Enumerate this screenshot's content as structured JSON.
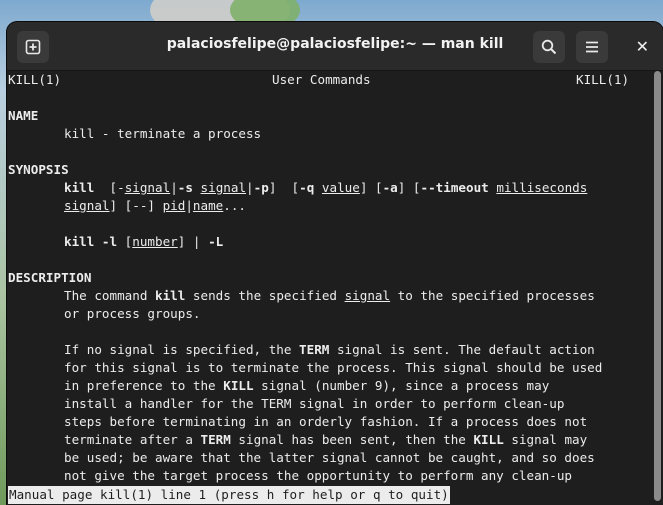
{
  "window": {
    "title": "palaciosfelipe@palaciosfelipe:~ — man kill",
    "new_tab_icon": "new-tab-icon",
    "search_icon": "search-icon",
    "menu_icon": "hamburger-menu-icon",
    "close_glyph": "✕"
  },
  "man": {
    "header_left": "KILL(1)",
    "header_center": "User Commands",
    "header_right": "KILL(1)",
    "name_heading": "NAME",
    "name_text": "kill - terminate a process",
    "synopsis_heading": "SYNOPSIS",
    "syn1": {
      "kill": "kill",
      "sp1": "  [-",
      "signal": "signal",
      "bar1": "|",
      "s": "-s",
      "sp2": " ",
      "signal2": "signal",
      "bar2": "|",
      "p": "-p",
      "sp3": "]  [",
      "q": "-q",
      "sp4": " ",
      "value": "value",
      "sp5": "] [",
      "a": "-a",
      "sp6": "] [",
      "timeout": "--timeout",
      "sp7": " ",
      "ms": "milliseconds"
    },
    "syn2": {
      "signal": "signal",
      "mid": "] [--] ",
      "pid": "pid",
      "bar": "|",
      "name": "name",
      "dots": "..."
    },
    "syn3": {
      "kill_l": "kill -l",
      "open": " [",
      "number": "number",
      "close": "] | ",
      "L": "-L"
    },
    "description_heading": "DESCRIPTION",
    "d1": {
      "a": "The command ",
      "kill": "kill",
      "b": " sends the specified ",
      "signal": "signal",
      "c": " to the specified processes"
    },
    "d2": "or process groups.",
    "d3": {
      "a": "If no signal is specified, the ",
      "term": "TERM",
      "b": " signal is sent. The default action"
    },
    "d4": "for this signal is to terminate the process. This signal should be used",
    "d5": {
      "a": "in preference to the ",
      "kill": "KILL",
      "b": " signal (number 9), since a process may"
    },
    "d6": "install a handler for the TERM signal in order to perform clean-up",
    "d7": "steps before terminating in an orderly fashion. If a process does not",
    "d8": {
      "a": "terminate after a ",
      "term": "TERM",
      "b": " signal has been sent, then the ",
      "kill": "KILL",
      "c": " signal may"
    },
    "d9": "be used; be aware that the latter signal cannot be caught, and so does",
    "d10": "not give the target process the opportunity to perform any clean-up"
  },
  "status_line": "Manual page kill(1) line 1 (press h for help or q to quit)"
}
